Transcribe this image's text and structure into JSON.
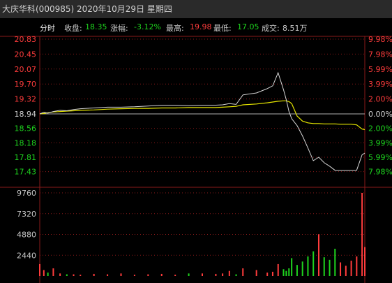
{
  "header": {
    "title": "大庆华科(000985) 2020年10月29日 星期四"
  },
  "info": {
    "mode_label": "分时",
    "close_label": "收盘:",
    "close_value": "18.35",
    "change_label": "涨幅:",
    "change_value": "-3.12%",
    "high_label": "最高:",
    "high_value": "19.98",
    "low_label": "最低:",
    "low_value": "17.05",
    "volume_label": "成交:",
    "volume_value": "8.51万"
  },
  "chart_data": {
    "type": "line",
    "base_price": 18.94,
    "price_ylim": [
      17.05,
      20.83
    ],
    "price_ticks_left": [
      "20.83",
      "20.45",
      "20.07",
      "19.70",
      "19.32",
      "18.94",
      "18.56",
      "18.18",
      "17.81",
      "17.43"
    ],
    "percent_ticks_right": [
      "9.98%",
      "7.98%",
      "5.99%",
      "3.99%",
      "2.00%",
      "0.00%",
      "2.00%",
      "3.99%",
      "5.99%",
      "7.98%"
    ],
    "volume_ticks": [
      "9760",
      "7320",
      "4880",
      "2440"
    ],
    "volume_ylim": [
      0,
      9760
    ],
    "x_minutes": [
      0,
      3,
      6,
      10,
      15,
      20,
      25,
      30,
      40,
      50,
      60,
      70,
      80,
      90,
      100,
      110,
      120,
      130,
      135,
      140,
      145,
      150,
      160,
      168,
      172,
      176,
      180,
      182,
      184,
      186,
      190,
      194,
      198,
      202,
      206,
      210,
      214,
      218,
      222,
      226,
      230,
      234,
      238,
      240
    ],
    "series": [
      {
        "values": [
          18.94,
          18.98,
          18.96,
          19.0,
          19.03,
          19.02,
          19.05,
          19.07,
          19.09,
          19.11,
          19.11,
          19.12,
          19.14,
          19.16,
          19.16,
          19.15,
          19.16,
          19.16,
          19.17,
          19.2,
          19.18,
          19.42,
          19.47,
          19.58,
          19.65,
          19.98,
          19.55,
          19.3,
          19.0,
          18.8,
          18.6,
          18.3,
          17.95,
          17.58,
          17.68,
          17.52,
          17.42,
          17.3,
          17.3,
          17.3,
          17.3,
          17.3,
          17.75,
          17.8
        ]
      },
      {
        "values": [
          18.94,
          18.95,
          18.97,
          18.99,
          19.0,
          19.01,
          19.02,
          19.03,
          19.04,
          19.06,
          19.07,
          19.08,
          19.08,
          19.09,
          19.09,
          19.1,
          19.1,
          19.1,
          19.11,
          19.12,
          19.13,
          19.17,
          19.19,
          19.22,
          19.24,
          19.26,
          19.27,
          19.27,
          19.25,
          19.2,
          18.88,
          18.73,
          18.68,
          18.66,
          18.66,
          18.65,
          18.65,
          18.65,
          18.64,
          18.64,
          18.64,
          18.62,
          18.5,
          18.48
        ]
      }
    ],
    "volume_bars": [
      1400,
      700,
      400,
      900,
      300,
      200,
      200,
      150,
      250,
      200,
      300,
      150,
      200,
      250,
      150,
      300,
      300,
      250,
      300,
      600,
      200,
      900,
      700,
      400,
      500,
      1400,
      800,
      600,
      900,
      2100,
      1300,
      1700,
      2300,
      2900,
      4900,
      2200,
      1900,
      3200,
      1600,
      1200,
      1800,
      2300,
      9760,
      3400
    ],
    "colors": {
      "price_line": "#d6d6d6",
      "avg_line": "#e6e600",
      "up": "#ff3c3c",
      "down": "#1ed41e",
      "grid": "#8a1a1a",
      "base": "#d0d0d0"
    }
  }
}
